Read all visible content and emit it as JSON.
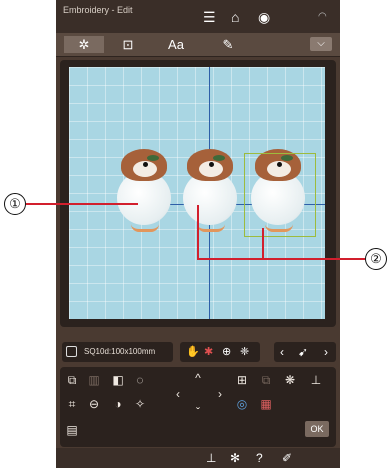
{
  "topbar": {
    "title": "Embroidery - Edit"
  },
  "icons": {
    "menu": "menu-icon",
    "home": "home-icon",
    "camera": "camera-icon",
    "wifi": "wifi-icon"
  },
  "tabs": [
    {
      "label": "✲"
    },
    {
      "label": "⊡"
    },
    {
      "label": "Aa"
    },
    {
      "label": "✎"
    }
  ],
  "dropdown": {
    "label": "⌵"
  },
  "status": {
    "hoop_size": "SQ10d:100x100mm"
  },
  "toolbar": {
    "ok_label": "OK"
  },
  "callouts": {
    "one": "①",
    "two": "②"
  },
  "colors": {
    "accent": "#d21f2d",
    "device": "#4a3a31",
    "grid": "#a9d6e3",
    "axis": "#2e5fa8"
  }
}
